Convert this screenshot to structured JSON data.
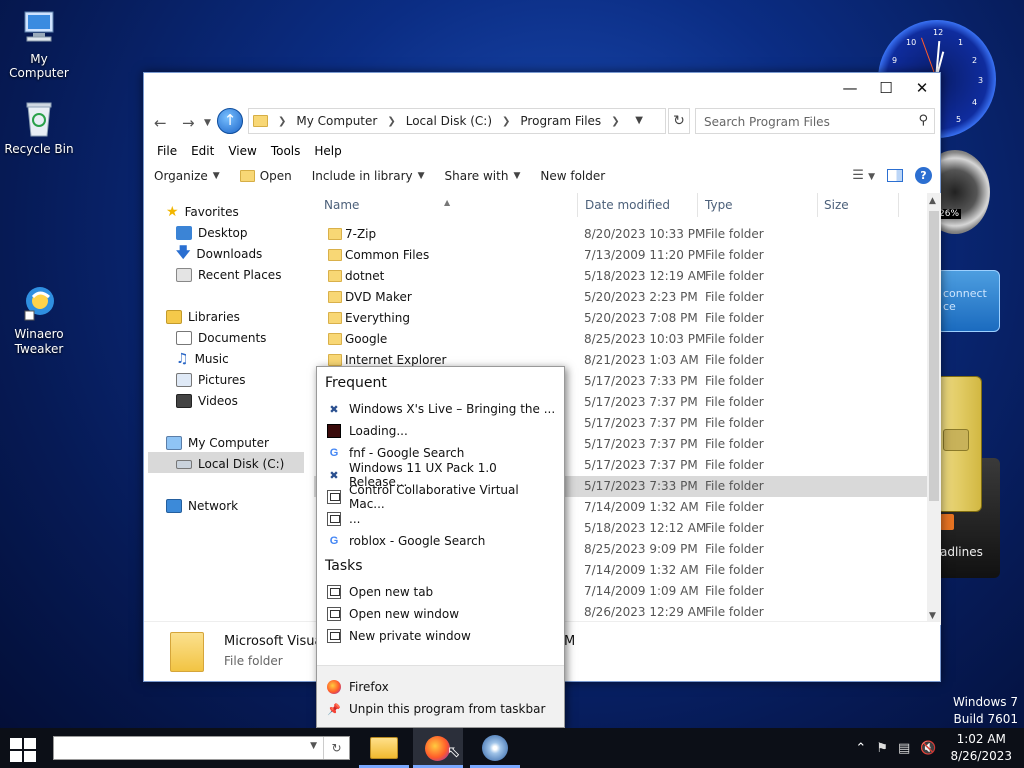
{
  "desktop": {
    "icons": [
      {
        "label": "My Computer"
      },
      {
        "label": "Recycle Bin"
      },
      {
        "label": "Winaero Tweaker"
      }
    ],
    "gadgets": {
      "meter_value": "26%",
      "blue_text": "connect ce",
      "headlines": "adlines"
    },
    "build": {
      "line1": "Windows 7",
      "line2": "Build 7601"
    }
  },
  "explorer": {
    "address": {
      "crumbs": [
        "My Computer",
        "Local Disk (C:)",
        "Program Files"
      ],
      "search_placeholder": "Search Program Files"
    },
    "menu": [
      "File",
      "Edit",
      "View",
      "Tools",
      "Help"
    ],
    "commands": {
      "organize": "Organize",
      "open": "Open",
      "include": "Include in library",
      "share": "Share with",
      "new_folder": "New folder"
    },
    "nav": {
      "favorites": "Favorites",
      "desktop": "Desktop",
      "downloads": "Downloads",
      "recent": "Recent Places",
      "libraries": "Libraries",
      "documents": "Documents",
      "music": "Music",
      "pictures": "Pictures",
      "videos": "Videos",
      "mycomputer": "My Computer",
      "localdisk": "Local Disk (C:)",
      "network": "Network"
    },
    "columns": {
      "name": "Name",
      "date": "Date modified",
      "type": "Type",
      "size": "Size"
    },
    "files": [
      {
        "name": "7-Zip",
        "date": "8/20/2023 10:33 PM",
        "type": "File folder"
      },
      {
        "name": "Common Files",
        "date": "7/13/2009 11:20 PM",
        "type": "File folder"
      },
      {
        "name": "dotnet",
        "date": "5/18/2023 12:19 AM",
        "type": "File folder"
      },
      {
        "name": "DVD Maker",
        "date": "5/20/2023 2:23 PM",
        "type": "File folder"
      },
      {
        "name": "Everything",
        "date": "5/20/2023 7:08 PM",
        "type": "File folder"
      },
      {
        "name": "Google",
        "date": "8/25/2023 10:03 PM",
        "type": "File folder"
      },
      {
        "name": "Internet Explorer",
        "date": "8/21/2023 1:03 AM",
        "type": "File folder"
      },
      {
        "name": "",
        "date": "5/17/2023 7:33 PM",
        "type": "File folder"
      },
      {
        "name": "",
        "date": "5/17/2023 7:37 PM",
        "type": "File folder"
      },
      {
        "name": "",
        "date": "5/17/2023 7:37 PM",
        "type": "File folder"
      },
      {
        "name": "",
        "date": "5/17/2023 7:37 PM",
        "type": "File folder"
      },
      {
        "name": "",
        "date": "5/17/2023 7:37 PM",
        "type": "File folder"
      },
      {
        "name": "",
        "date": "5/17/2023 7:33 PM",
        "type": "File folder"
      },
      {
        "name": "",
        "date": "7/14/2009 1:32 AM",
        "type": "File folder"
      },
      {
        "name": "",
        "date": "5/18/2023 12:12 AM",
        "type": "File folder"
      },
      {
        "name": "",
        "date": "8/25/2023 9:09 PM",
        "type": "File folder"
      },
      {
        "name": "",
        "date": "7/14/2009 1:32 AM",
        "type": "File folder"
      },
      {
        "name": "",
        "date": "7/14/2009 1:09 AM",
        "type": "File folder"
      },
      {
        "name": "",
        "date": "8/26/2023 12:29 AM",
        "type": "File folder"
      }
    ],
    "details": {
      "name": "Microsoft Visual",
      "type": "File folder",
      "extra": "M"
    }
  },
  "jumplist": {
    "frequent_header": "Frequent",
    "frequent": [
      {
        "label": "Windows X's Live – Bringing the ...",
        "icon": "winx-icon"
      },
      {
        "label": "Loading...",
        "icon": "site-icon"
      },
      {
        "label": "fnf - Google Search",
        "icon": "google-icon"
      },
      {
        "label": "Windows 11 UX Pack 1.0 Release...",
        "icon": "winx-icon"
      },
      {
        "label": "Control Collaborative Virtual Mac...",
        "icon": "page-icon"
      },
      {
        "label": "...",
        "icon": "page-icon"
      },
      {
        "label": "roblox - Google Search",
        "icon": "google-icon"
      }
    ],
    "tasks_header": "Tasks",
    "tasks": [
      {
        "label": "Open new tab"
      },
      {
        "label": "Open new window"
      },
      {
        "label": "New private window"
      }
    ],
    "footer": {
      "app": "Firefox",
      "unpin": "Unpin this program from taskbar"
    }
  },
  "taskbar": {
    "clock_time": "1:02 AM",
    "clock_date": "8/26/2023"
  }
}
